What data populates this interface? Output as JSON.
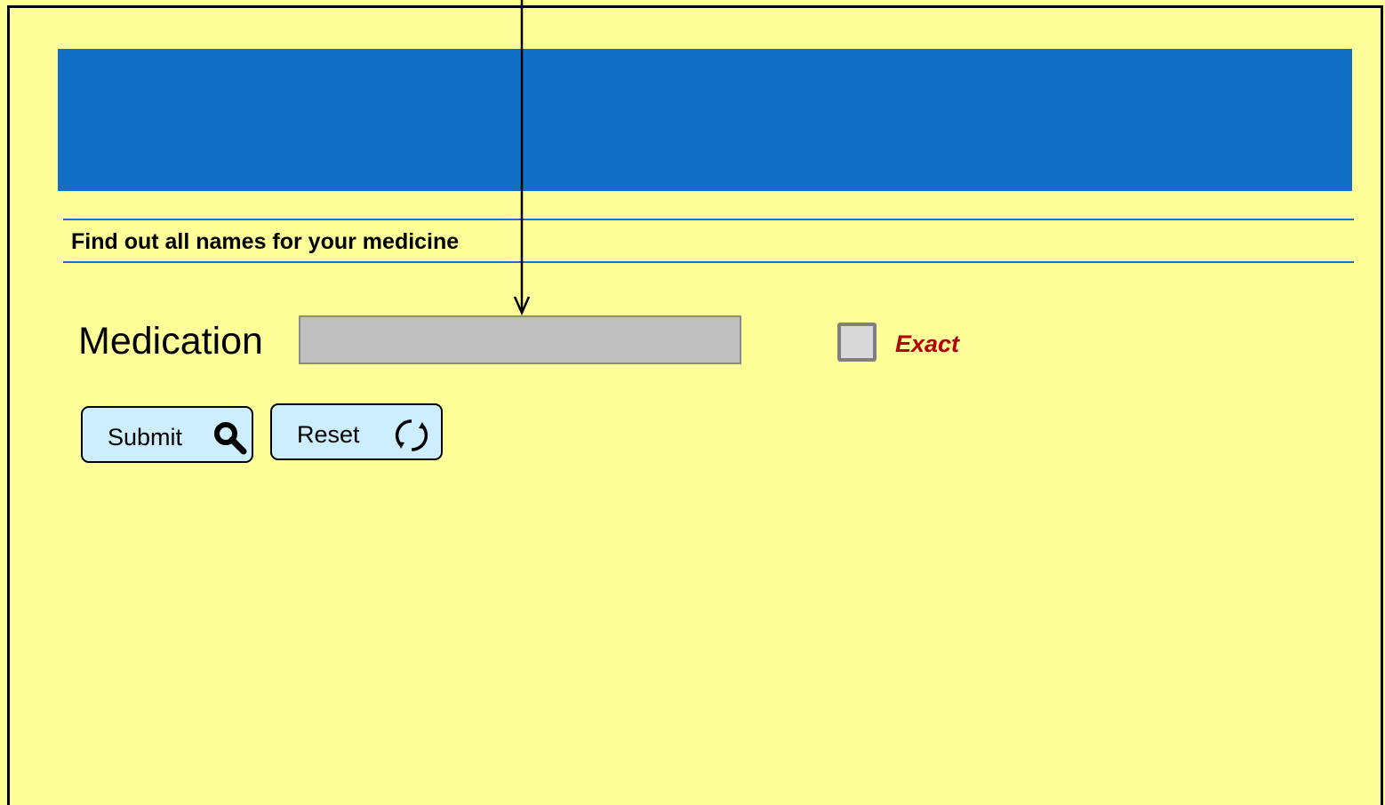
{
  "subtitle": "Find out all names for your medicine",
  "form": {
    "medication_label": "Medication",
    "medication_value": "",
    "exact_label": "Exact",
    "exact_checked": false
  },
  "buttons": {
    "submit_label": "Submit",
    "reset_label": "Reset"
  },
  "icons": {
    "submit": "search-icon",
    "reset": "refresh-icon",
    "pointer": "arrow-down-icon"
  },
  "colors": {
    "background": "#ffff99",
    "banner": "#1170c6",
    "button": "#cceeff",
    "exact": "#b30000"
  }
}
